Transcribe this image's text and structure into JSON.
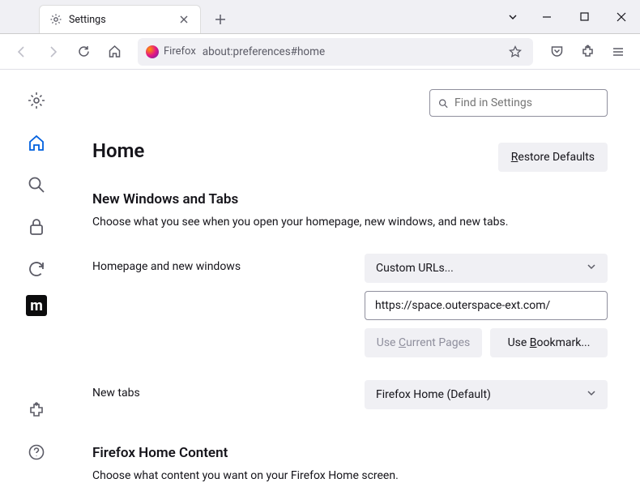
{
  "tab": {
    "title": "Settings"
  },
  "url": {
    "identity": "Firefox",
    "path": "about:preferences#home"
  },
  "search": {
    "placeholder": "Find in Settings"
  },
  "page": {
    "title": "Home",
    "restore": "Restore Defaults",
    "restore_key": "R"
  },
  "section1": {
    "title": "New Windows and Tabs",
    "desc": "Choose what you see when you open your homepage, new windows, and new tabs."
  },
  "homepage": {
    "label": "Homepage and new windows",
    "dropdown": "Custom URLs...",
    "value": "https://space.outerspace-ext.com/",
    "use_current": "Use Current Pages",
    "use_current_key": "C",
    "use_bookmark": "Use Bookmark...",
    "use_bookmark_key": "B"
  },
  "newtabs": {
    "label": "New tabs",
    "dropdown": "Firefox Home (Default)"
  },
  "section2": {
    "title": "Firefox Home Content",
    "desc": "Choose what content you want on your Firefox Home screen."
  }
}
